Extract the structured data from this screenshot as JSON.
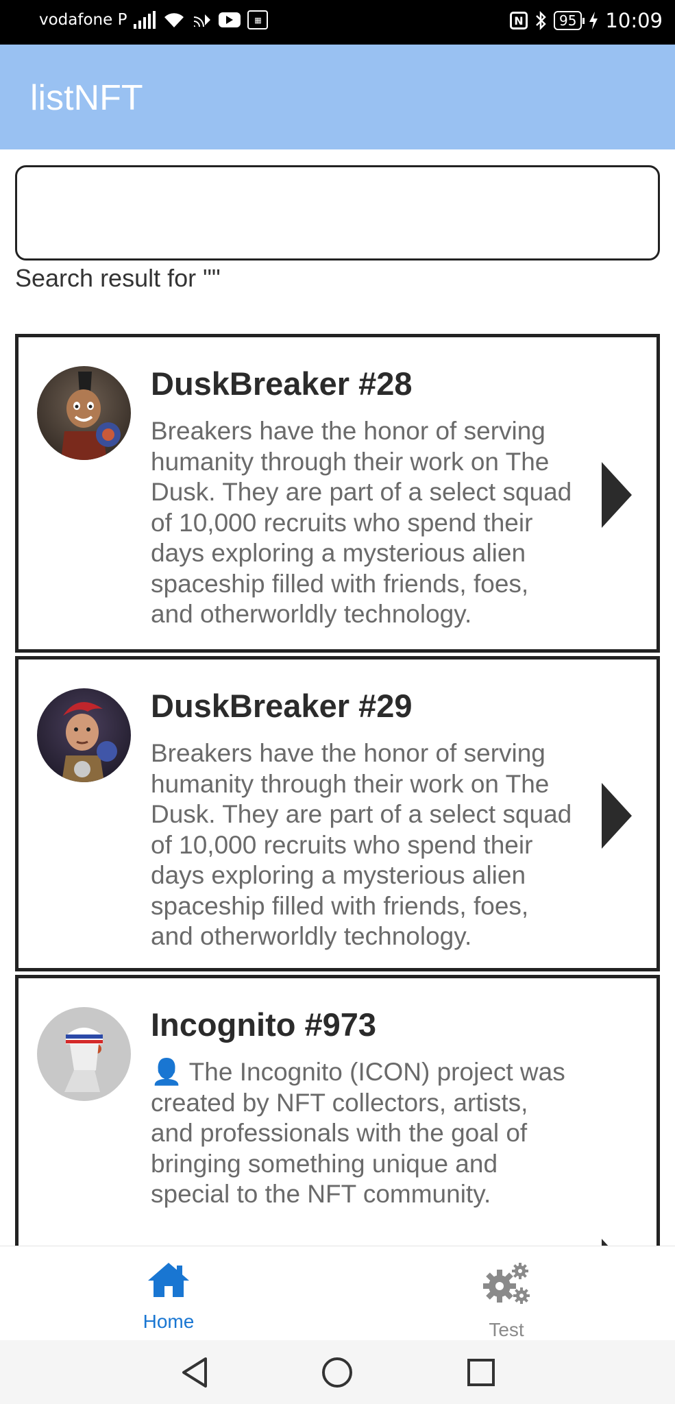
{
  "status_bar": {
    "carrier": "vodafone P",
    "battery": "95",
    "time": "10:09"
  },
  "app_bar": {
    "title": "listNFT"
  },
  "search": {
    "value": "",
    "result_text": "Search result for \"\""
  },
  "items": [
    {
      "title": "DuskBreaker #28",
      "description": "Breakers have the honor of serving humanity through their work on The Dusk. They are part of a select squad of 10,000 recruits who spend their days exploring a mysterious alien spaceship filled with friends, foes, and otherworldly technology."
    },
    {
      "title": "DuskBreaker #29",
      "description": "Breakers have the honor of serving humanity through their work on The Dusk. They are part of a select squad of 10,000 recruits who spend their days exploring a mysterious alien spaceship filled with friends, foes, and otherworldly technology."
    },
    {
      "title": "Incognito #973",
      "description": "👤 The Incognito (ICON) project was created by NFT collectors, artists, and professionals with the goal of bringing something unique and special to the NFT community."
    }
  ],
  "bottom_nav": {
    "home": {
      "label": "Home",
      "icon": "home-icon",
      "color": "#1976d2"
    },
    "test": {
      "label": "Test",
      "icon": "gears-icon",
      "color": "#8a8a8a"
    }
  },
  "colors": {
    "app_bar": "#99c1f2",
    "accent": "#1976d2",
    "card_border": "#222222"
  }
}
